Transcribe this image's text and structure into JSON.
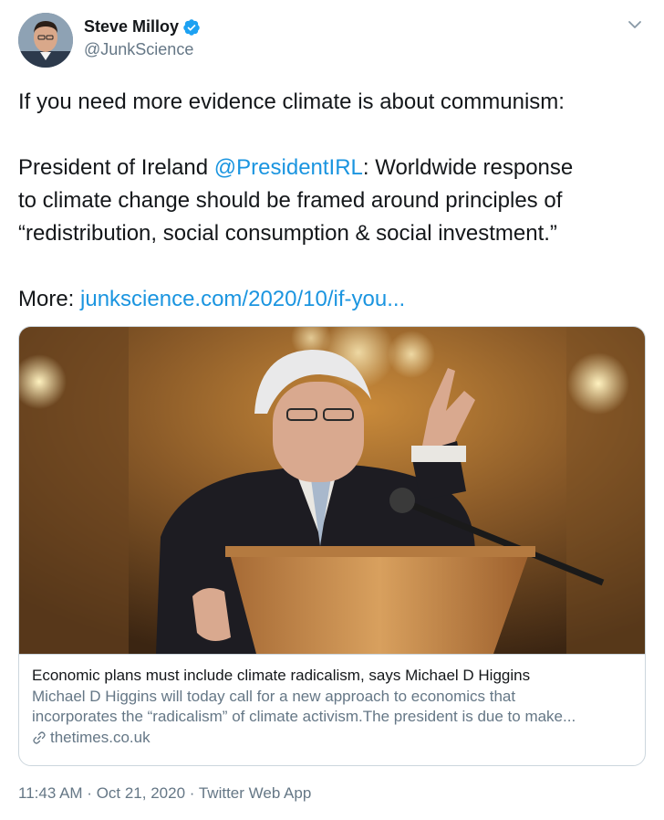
{
  "author": {
    "name": "Steve Milloy",
    "handle": "@JunkScience",
    "verified_icon": "verified-badge-icon",
    "menu_icon": "chevron-down-icon"
  },
  "tweet": {
    "line1": "If you need more evidence climate is about communism:",
    "line2_prefix": "President of Ireland ",
    "line2_mention": "@PresidentIRL",
    "line2_suffix": ": Worldwide response",
    "line3": "to climate change should be framed around principles of",
    "line4": "“redistribution, social consumption & social investment.”",
    "more_label": "More: ",
    "more_link": "junkscience.com/2020/10/if-you..."
  },
  "card": {
    "title": "Economic plans must include climate radicalism, says Michael D Higgins",
    "desc_line1": "Michael D Higgins will today call for a new approach to economics that",
    "desc_line2": "incorporates the “radicalism” of climate activism.The president is due to make...",
    "domain": "thetimes.co.uk",
    "domain_icon": "link-icon",
    "image_subject": "photo-of-president-speaking-at-podium"
  },
  "meta": {
    "time": "11:43 AM",
    "sep1": " · ",
    "date": "Oct 21, 2020",
    "sep2": " · ",
    "source": "Twitter Web App"
  },
  "colors": {
    "link": "#1b95e0",
    "secondary": "#657786",
    "border": "#ccd6dd",
    "text": "#14171a"
  }
}
